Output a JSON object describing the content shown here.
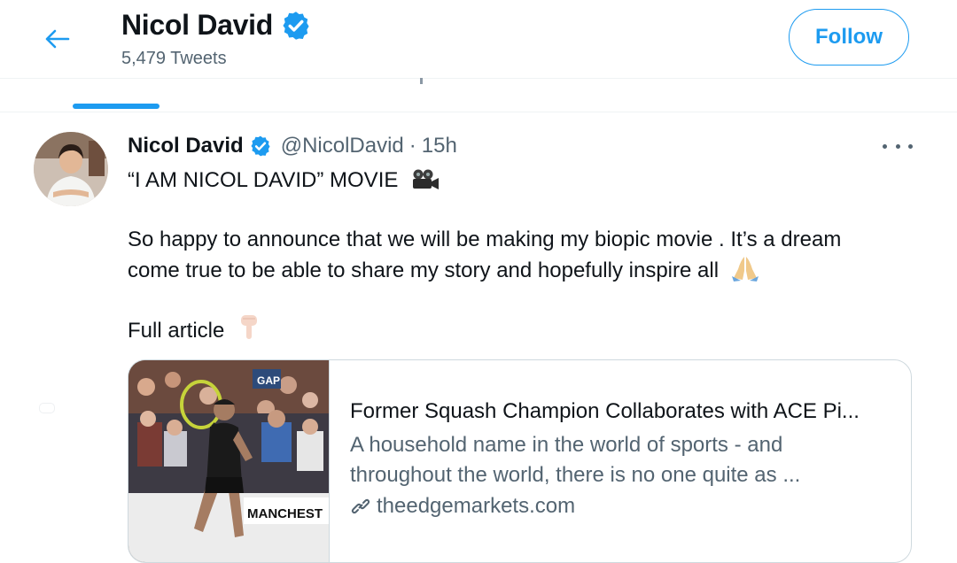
{
  "header": {
    "title": "Nicol David",
    "tweet_count": "5,479 Tweets",
    "follow_label": "Follow"
  },
  "tweet": {
    "author": "Nicol David",
    "handle": "@NicolDavid",
    "separator": "·",
    "time": "15h",
    "line1": "“I AM NICOL DAVID” MOVIE",
    "para2_line1": "So happy to announce that we will be making my biopic movie . It’s a dream",
    "para2_line2": "come true to be able to share my story and hopefully inspire all",
    "para3": "Full article",
    "card": {
      "title": "Former Squash Champion Collaborates with ACE Pi...",
      "desc_line1": "A household name in the world of sports - and",
      "desc_line2": "throughout the world, there is no one quite as ...",
      "domain": "theedgemarkets.com",
      "image_banner_text": "MANCHEST",
      "image_sign_text": "GAP"
    }
  },
  "colors": {
    "accent": "#1d9bf0",
    "secondary_text": "#536471",
    "border": "#cfd9de"
  },
  "icons": {
    "back": "arrow-left-icon",
    "verified": "verified-badge-icon",
    "more": "more-horizontal-icon",
    "link": "link-icon",
    "movie_camera": "movie-camera-icon",
    "praying_hands": "praying-hands-icon",
    "pointing_down": "backhand-pointing-down-icon"
  }
}
